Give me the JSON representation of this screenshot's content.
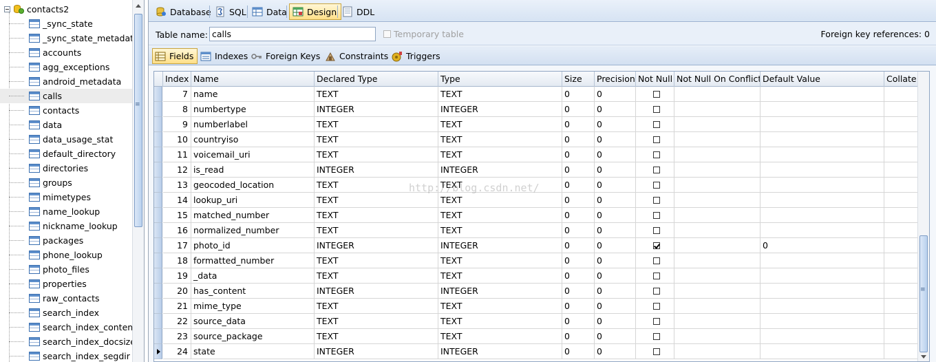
{
  "tree": {
    "root_label": "contacts2",
    "items": [
      "_sync_state",
      "_sync_state_metadata",
      "accounts",
      "agg_exceptions",
      "android_metadata",
      "calls",
      "contacts",
      "data",
      "data_usage_stat",
      "default_directory",
      "directories",
      "groups",
      "mimetypes",
      "name_lookup",
      "nickname_lookup",
      "packages",
      "phone_lookup",
      "photo_files",
      "properties",
      "raw_contacts",
      "search_index",
      "search_index_content",
      "search_index_docsize",
      "search_index_segdir"
    ],
    "selected": "calls"
  },
  "top_tabs": [
    {
      "label": "Database",
      "icon": "database-icon"
    },
    {
      "label": "SQL",
      "icon": "sql-icon"
    },
    {
      "label": "Data",
      "icon": "data-grid-icon"
    },
    {
      "label": "Design",
      "icon": "design-icon",
      "active": true
    },
    {
      "label": "DDL",
      "icon": "ddl-icon"
    }
  ],
  "table_name": {
    "label": "Table name:",
    "value": "calls",
    "temporary_label": "Temporary table",
    "fk_label": "Foreign key references: 0"
  },
  "sub_tabs": [
    {
      "label": "Fields",
      "icon": "fields-icon",
      "active": true
    },
    {
      "label": "Indexes",
      "icon": "indexes-icon"
    },
    {
      "label": "Foreign Keys",
      "icon": "key-icon"
    },
    {
      "label": "Constraints",
      "icon": "constraints-icon"
    },
    {
      "label": "Triggers",
      "icon": "triggers-icon"
    }
  ],
  "grid": {
    "columns": [
      "Index",
      "Name",
      "Declared Type",
      "Type",
      "Size",
      "Precision",
      "Not Null",
      "Not Null On Conflict",
      "Default Value",
      "Collate"
    ],
    "rows": [
      {
        "index": "7",
        "name": "name",
        "declared": "TEXT",
        "type": "TEXT",
        "size": "0",
        "precision": "0",
        "notnull": false,
        "default": ""
      },
      {
        "index": "8",
        "name": "numbertype",
        "declared": "INTEGER",
        "type": "INTEGER",
        "size": "0",
        "precision": "0",
        "notnull": false,
        "default": ""
      },
      {
        "index": "9",
        "name": "numberlabel",
        "declared": "TEXT",
        "type": "TEXT",
        "size": "0",
        "precision": "0",
        "notnull": false,
        "default": ""
      },
      {
        "index": "10",
        "name": "countryiso",
        "declared": "TEXT",
        "type": "TEXT",
        "size": "0",
        "precision": "0",
        "notnull": false,
        "default": ""
      },
      {
        "index": "11",
        "name": "voicemail_uri",
        "declared": "TEXT",
        "type": "TEXT",
        "size": "0",
        "precision": "0",
        "notnull": false,
        "default": ""
      },
      {
        "index": "12",
        "name": "is_read",
        "declared": "INTEGER",
        "type": "INTEGER",
        "size": "0",
        "precision": "0",
        "notnull": false,
        "default": ""
      },
      {
        "index": "13",
        "name": "geocoded_location",
        "declared": "TEXT",
        "type": "TEXT",
        "size": "0",
        "precision": "0",
        "notnull": false,
        "default": ""
      },
      {
        "index": "14",
        "name": "lookup_uri",
        "declared": "TEXT",
        "type": "TEXT",
        "size": "0",
        "precision": "0",
        "notnull": false,
        "default": ""
      },
      {
        "index": "15",
        "name": "matched_number",
        "declared": "TEXT",
        "type": "TEXT",
        "size": "0",
        "precision": "0",
        "notnull": false,
        "default": ""
      },
      {
        "index": "16",
        "name": "normalized_number",
        "declared": "TEXT",
        "type": "TEXT",
        "size": "0",
        "precision": "0",
        "notnull": false,
        "default": ""
      },
      {
        "index": "17",
        "name": "photo_id",
        "declared": "INTEGER",
        "type": "INTEGER",
        "size": "0",
        "precision": "0",
        "notnull": true,
        "default": "0"
      },
      {
        "index": "18",
        "name": "formatted_number",
        "declared": "TEXT",
        "type": "TEXT",
        "size": "0",
        "precision": "0",
        "notnull": false,
        "default": ""
      },
      {
        "index": "19",
        "name": "_data",
        "declared": "TEXT",
        "type": "TEXT",
        "size": "0",
        "precision": "0",
        "notnull": false,
        "default": ""
      },
      {
        "index": "20",
        "name": "has_content",
        "declared": "INTEGER",
        "type": "INTEGER",
        "size": "0",
        "precision": "0",
        "notnull": false,
        "default": ""
      },
      {
        "index": "21",
        "name": "mime_type",
        "declared": "TEXT",
        "type": "TEXT",
        "size": "0",
        "precision": "0",
        "notnull": false,
        "default": ""
      },
      {
        "index": "22",
        "name": "source_data",
        "declared": "TEXT",
        "type": "TEXT",
        "size": "0",
        "precision": "0",
        "notnull": false,
        "default": ""
      },
      {
        "index": "23",
        "name": "source_package",
        "declared": "TEXT",
        "type": "TEXT",
        "size": "0",
        "precision": "0",
        "notnull": false,
        "default": ""
      },
      {
        "index": "24",
        "name": "state",
        "declared": "INTEGER",
        "type": "INTEGER",
        "size": "0",
        "precision": "0",
        "notnull": false,
        "default": "",
        "current": true
      }
    ]
  },
  "watermark": "http://blog.csdn.net/"
}
